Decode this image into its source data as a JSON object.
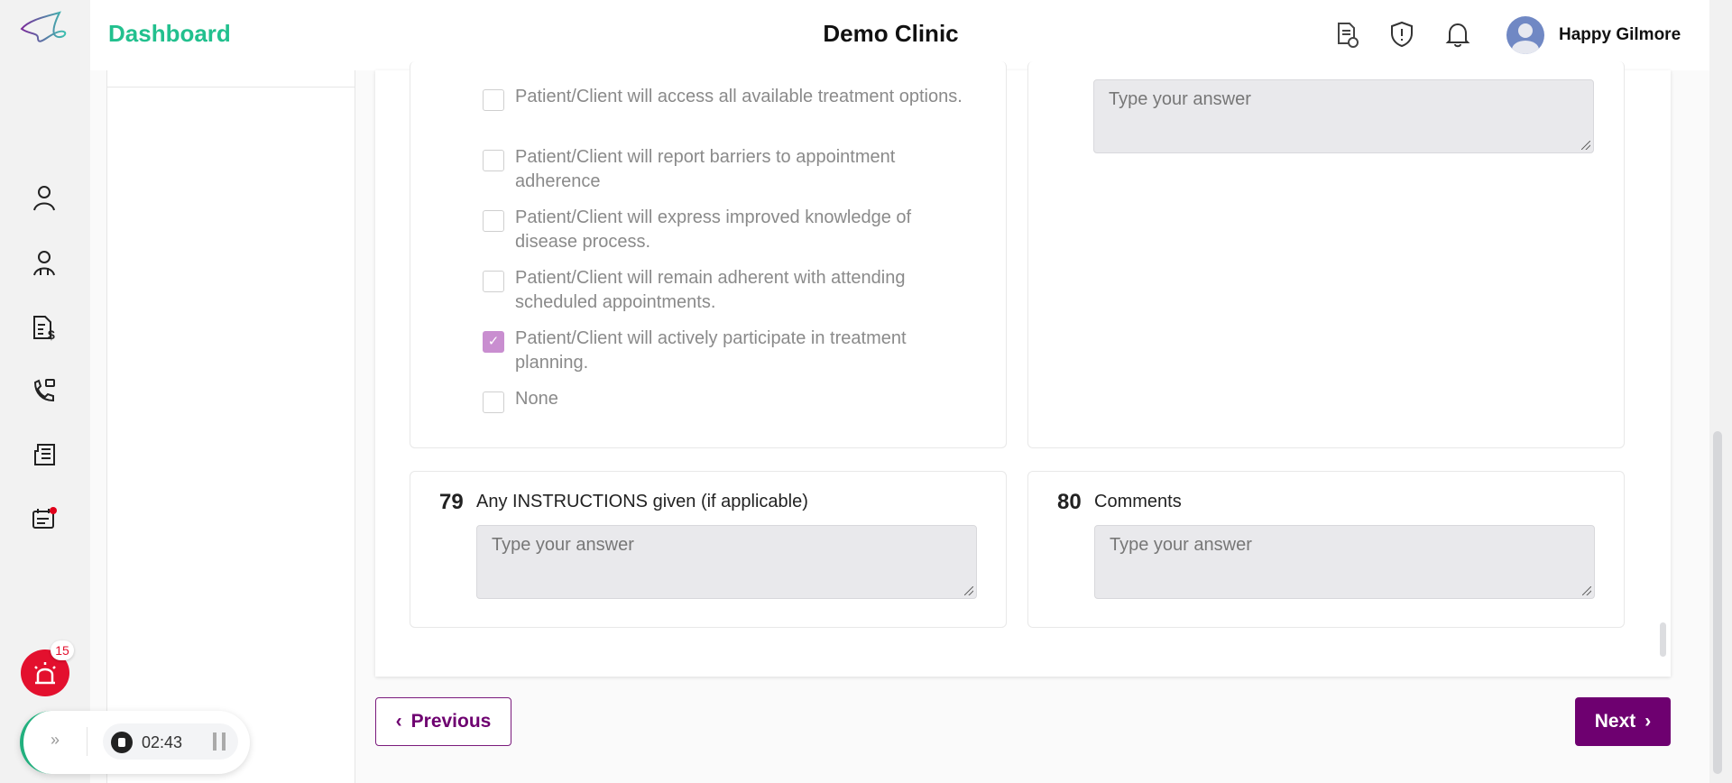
{
  "header": {
    "title": "Dashboard",
    "clinic": "Demo Clinic",
    "user_name": "Happy Gilmore"
  },
  "sidebar": {
    "icons": [
      "user-icon",
      "doctor-icon",
      "billing-icon",
      "phone-icon",
      "news-icon",
      "calendar-icon"
    ],
    "alert_count": "15"
  },
  "recorder": {
    "time": "02:43"
  },
  "goals": {
    "options": [
      {
        "label": "Patient/Client will access all available treatment options.",
        "checked": false
      },
      {
        "label": "Patient/Client will report barriers to appointment adherence",
        "checked": false
      },
      {
        "label": "Patient/Client will express improved knowledge of disease process.",
        "checked": false
      },
      {
        "label": "Patient/Client will remain adherent with attending scheduled appointments.",
        "checked": false
      },
      {
        "label": "Patient/Client will actively participate in treatment planning.",
        "checked": true
      },
      {
        "label": "None",
        "checked": false
      }
    ]
  },
  "questions": [
    {
      "number": "79",
      "label": "Any INSTRUCTIONS given (if applicable)",
      "placeholder": "Type your answer"
    },
    {
      "number": "80",
      "label": "Comments",
      "placeholder": "Type your answer"
    }
  ],
  "top_right_placeholder": "Type your answer",
  "nav": {
    "previous": "Previous",
    "next": "Next"
  },
  "colors": {
    "brand": "#6e0070",
    "accent": "#22c08e",
    "checked": "#c98ed0"
  }
}
